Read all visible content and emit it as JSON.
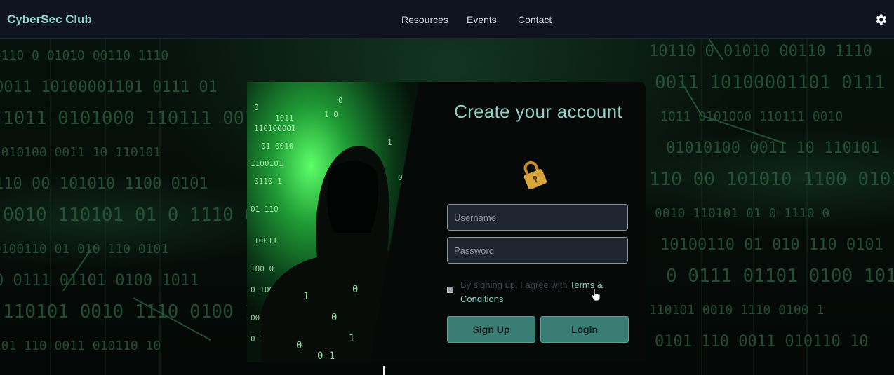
{
  "navbar": {
    "brand": "CyberSec Club",
    "links": [
      "Resources",
      "Events",
      "Contact"
    ],
    "settings_icon": "gear-icon"
  },
  "form": {
    "title": "Create your account",
    "icon": "lock-icon",
    "username_placeholder": "Username",
    "password_placeholder": "Password",
    "terms_text": "By signing up, I agree with ",
    "terms_link": "Terms & Conditions",
    "signup_label": "Sign Up",
    "login_label": "Login"
  },
  "colors": {
    "accent": "#8ed1c3",
    "button": "#3a7d74",
    "navbar_bg": "#0f1420",
    "lock": "#d9a53a"
  },
  "background": {
    "binary_rows": [
      "10110 0 01010 00110 1110",
      "0011 10100001101 0111 01",
      "1011 0101000 110111 0010",
      "01010100 0011 10 110101",
      "110 00 101010 1100 0101",
      "0010 110101 01 0 1110 0",
      "10100110 01 010 110 0101",
      "0 0111 01101 0100 1011",
      "110101 0010 1110 0100 1",
      "0101 110 0011 010110 10"
    ]
  }
}
